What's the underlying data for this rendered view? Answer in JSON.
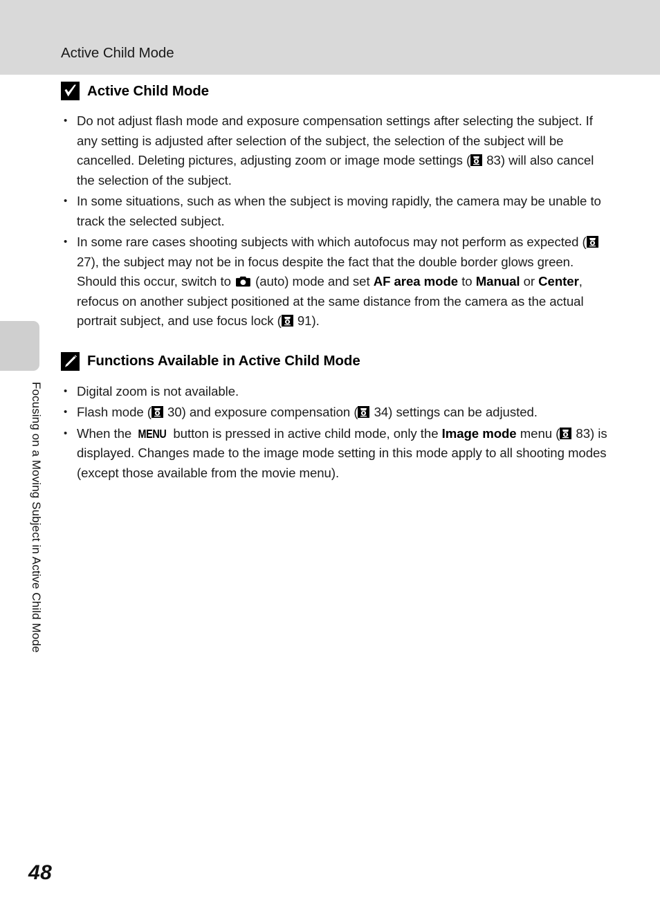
{
  "header": {
    "title": "Active Child Mode"
  },
  "side_tab": {
    "label": "Focusing on a Moving Subject in Active Child Mode"
  },
  "page": {
    "number": "48"
  },
  "colors": {
    "header_band": "#d9d9d9",
    "side_tab": "#cfcfcf",
    "text": "#1c1c1c",
    "icon_box": "#000000"
  },
  "sections": [
    {
      "icon": "checkmark-box-icon",
      "title": "Active Child Mode",
      "bullets": [
        {
          "parts": [
            {
              "type": "text",
              "value": "Do not adjust flash mode and exposure compensation settings after selecting the subject. If any setting is adjusted after selection of the subject, the selection of the subject will be cancelled. Deleting pictures, adjusting zoom or image mode settings ("
            },
            {
              "type": "reficon",
              "value": "page-ref-icon"
            },
            {
              "type": "text",
              "value": " 83) will also cancel the selection of the subject."
            }
          ]
        },
        {
          "parts": [
            {
              "type": "text",
              "value": "In some situations, such as when the subject is moving rapidly, the camera may be unable to track the selected subject."
            }
          ]
        },
        {
          "parts": [
            {
              "type": "text",
              "value": "In some rare cases shooting subjects with which autofocus may not perform as expected ("
            },
            {
              "type": "reficon",
              "value": "page-ref-icon"
            },
            {
              "type": "text",
              "value": " 27), the subject may not be in focus despite the fact that the double border glows green. Should this occur, switch to "
            },
            {
              "type": "camicon",
              "value": "camera-auto-mode-icon"
            },
            {
              "type": "text",
              "value": " (auto) mode and set "
            },
            {
              "type": "bold",
              "value": "AF area mode"
            },
            {
              "type": "text",
              "value": " to "
            },
            {
              "type": "bold",
              "value": "Manual"
            },
            {
              "type": "text",
              "value": " or "
            },
            {
              "type": "bold",
              "value": "Center"
            },
            {
              "type": "text",
              "value": ", refocus on another subject positioned at the same distance from the camera as the actual portrait subject, and use focus lock ("
            },
            {
              "type": "reficon",
              "value": "page-ref-icon"
            },
            {
              "type": "text",
              "value": " 91)."
            }
          ]
        }
      ]
    },
    {
      "icon": "pencil-box-icon",
      "title": "Functions Available in Active Child Mode",
      "bullets": [
        {
          "parts": [
            {
              "type": "text",
              "value": "Digital zoom is not available."
            }
          ]
        },
        {
          "parts": [
            {
              "type": "text",
              "value": "Flash mode ("
            },
            {
              "type": "reficon",
              "value": "page-ref-icon"
            },
            {
              "type": "text",
              "value": " 30) and exposure compensation ("
            },
            {
              "type": "reficon",
              "value": "page-ref-icon"
            },
            {
              "type": "text",
              "value": " 34) settings can be adjusted."
            }
          ]
        },
        {
          "parts": [
            {
              "type": "text",
              "value": "When the "
            },
            {
              "type": "menuglyph",
              "value": "MENU"
            },
            {
              "type": "text",
              "value": " button is pressed in active child mode, only the "
            },
            {
              "type": "bold",
              "value": "Image mode"
            },
            {
              "type": "text",
              "value": " menu ("
            },
            {
              "type": "reficon",
              "value": "page-ref-icon"
            },
            {
              "type": "text",
              "value": " 83) is displayed. Changes made to the image mode setting in this mode apply to all shooting modes (except those available from the movie menu)."
            }
          ]
        }
      ]
    }
  ]
}
